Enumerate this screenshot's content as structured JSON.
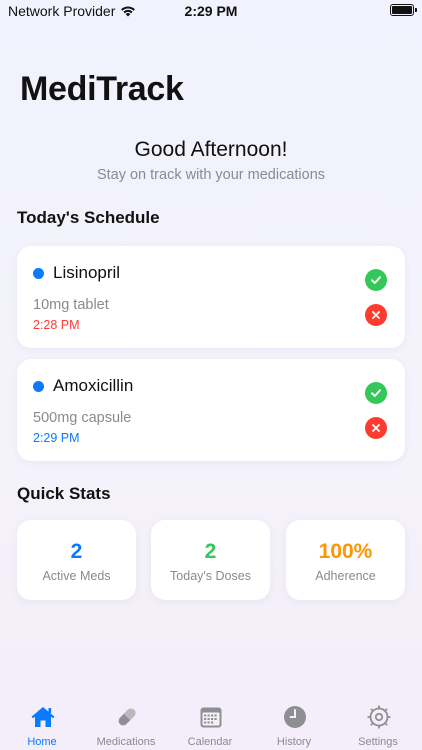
{
  "status_bar": {
    "carrier": "Network Provider",
    "time": "2:29 PM",
    "battery_level": 1.0
  },
  "header": {
    "app_title": "MediTrack",
    "greeting": "Good Afternoon!",
    "subtitle": "Stay on track with your medications"
  },
  "schedule": {
    "title": "Today's Schedule",
    "items": [
      {
        "name": "Lisinopril",
        "dose": "10mg tablet",
        "time": "2:28 PM",
        "dot_color": "#0a7aff",
        "time_color": "#ff3b30"
      },
      {
        "name": "Amoxicillin",
        "dose": "500mg capsule",
        "time": "2:29 PM",
        "dot_color": "#0a7aff",
        "time_color": "#0a7aff"
      }
    ]
  },
  "stats": {
    "title": "Quick Stats",
    "items": [
      {
        "value": "2",
        "label": "Active Meds",
        "color": "#0a7aff"
      },
      {
        "value": "2",
        "label": "Today's Doses",
        "color": "#34c759"
      },
      {
        "value": "100%",
        "label": "Adherence",
        "color": "#ff9500"
      }
    ]
  },
  "tabs": [
    {
      "label": "Home",
      "icon": "house-icon",
      "active": true
    },
    {
      "label": "Medications",
      "icon": "pill-icon",
      "active": false
    },
    {
      "label": "Calendar",
      "icon": "calendar-icon",
      "active": false
    },
    {
      "label": "History",
      "icon": "clock-icon",
      "active": false
    },
    {
      "label": "Settings",
      "icon": "gear-icon",
      "active": false
    }
  ],
  "colors": {
    "accent": "#0a7aff",
    "success": "#34c759",
    "danger": "#ff3b30",
    "warning": "#ff9500",
    "inactive_icon": "#8e8e93"
  }
}
